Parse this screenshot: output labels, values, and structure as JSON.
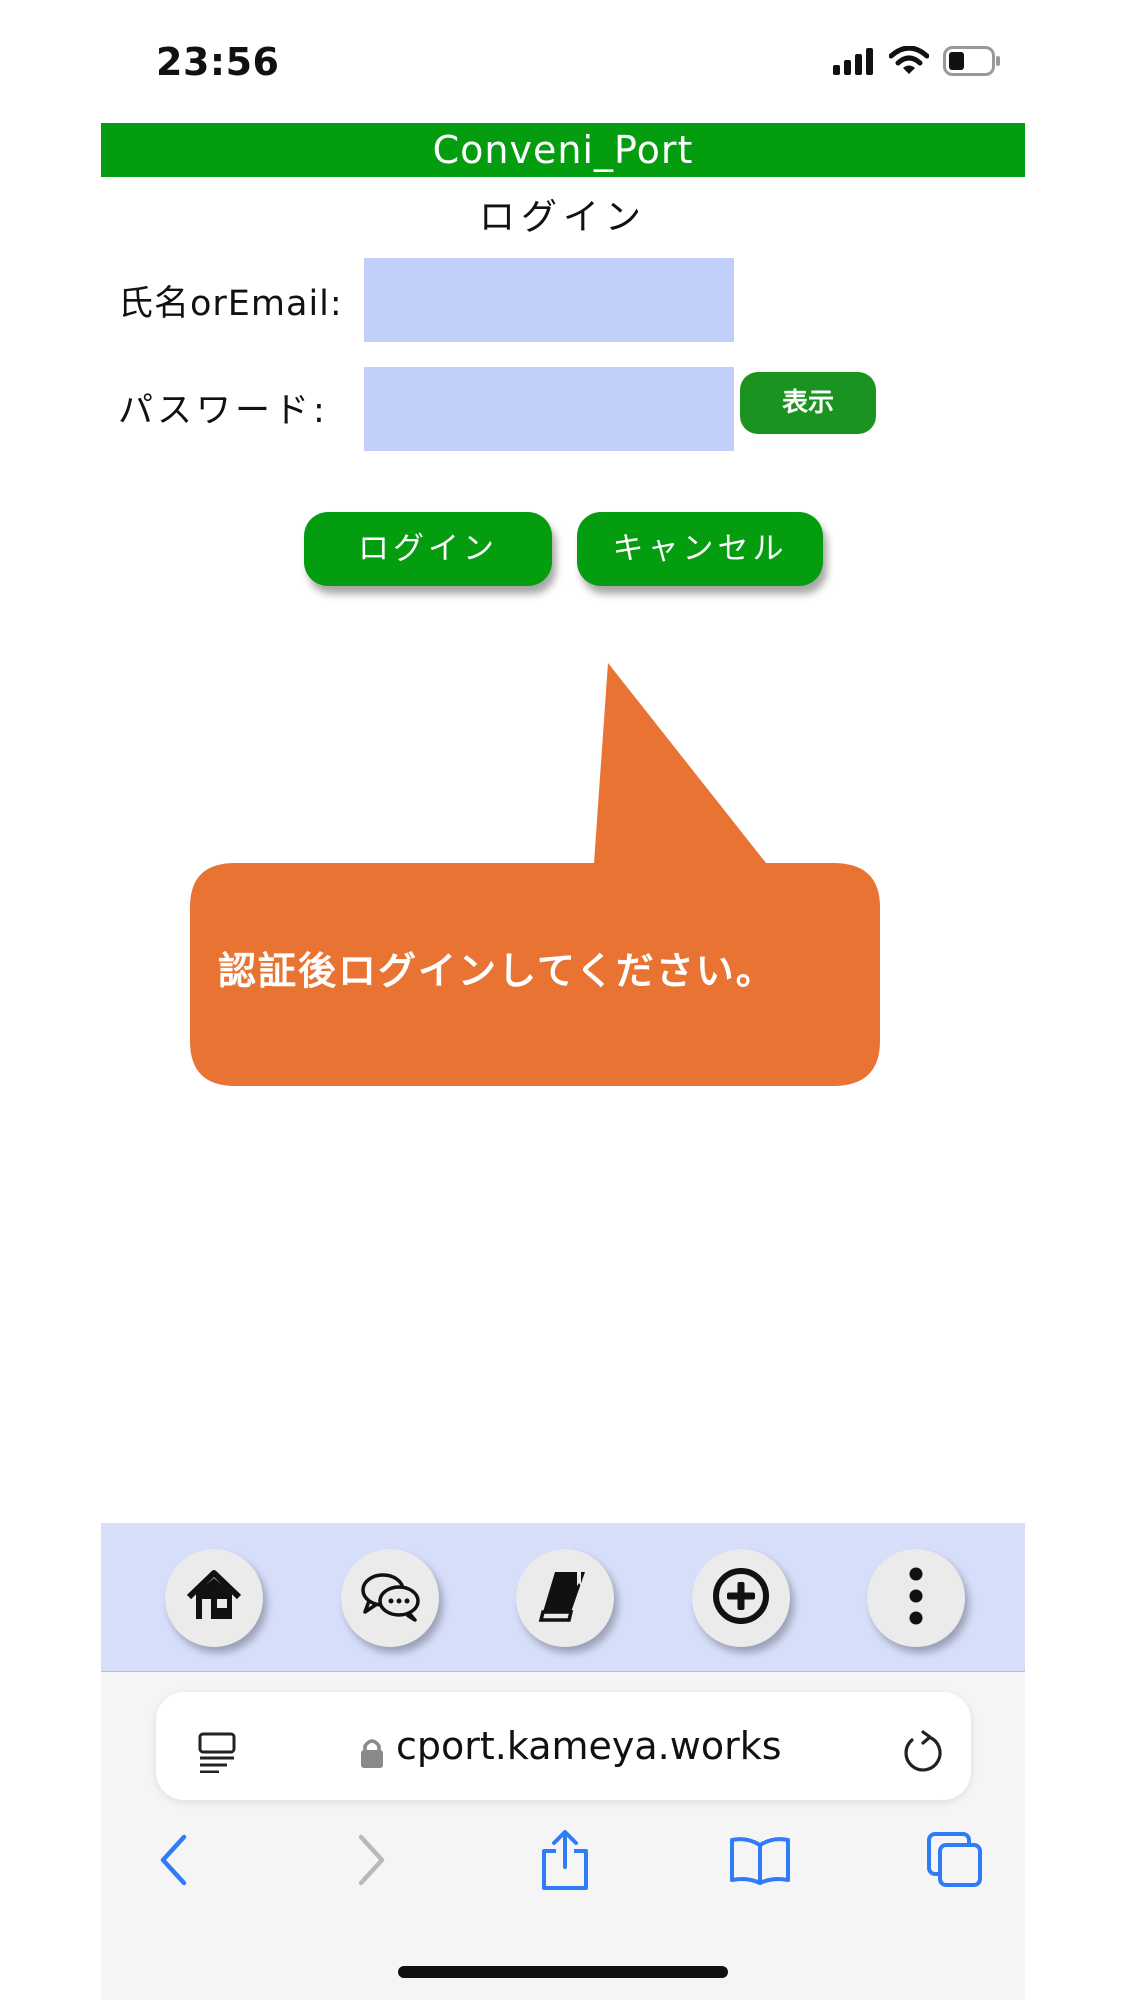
{
  "status_bar": {
    "time": "23:56",
    "icons": [
      "signal-icon",
      "wifi-icon",
      "battery-icon"
    ]
  },
  "app": {
    "title": "Conveni_Port",
    "page_title": "ログイン",
    "form": {
      "email_label": "氏名orEmail:",
      "email_value": "",
      "password_label": "パスワード:",
      "password_value": "",
      "show_label": "表示"
    },
    "buttons": {
      "login": "ログイン",
      "cancel": "キャンセル"
    },
    "message": "認証後ログインしてください。",
    "nav": [
      "home-icon",
      "chat-icon",
      "book-icon",
      "add-circle-icon",
      "more-vert-icon"
    ]
  },
  "browser": {
    "url": "cport.kameya.works",
    "toolbar": [
      "back-icon",
      "forward-icon",
      "share-icon",
      "bookmarks-icon",
      "tabs-icon"
    ]
  },
  "colors": {
    "header_green": "#049d0f",
    "input_bg": "#c1cffa",
    "bubble": "#e97333",
    "nav_bg": "#d6defa",
    "safari_blue": "#2f7cf6"
  }
}
